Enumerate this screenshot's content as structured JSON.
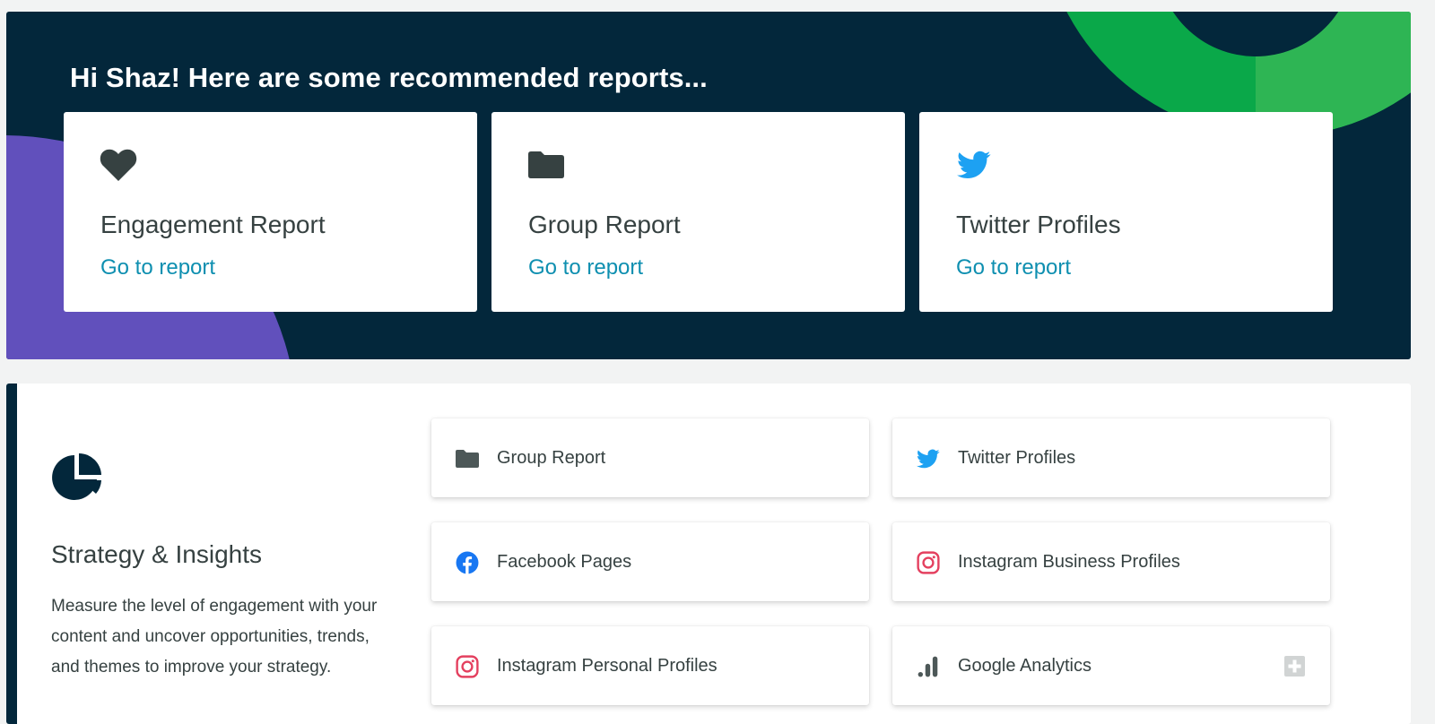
{
  "hero": {
    "title": "Hi Shaz! Here are some recommended reports...",
    "cards": [
      {
        "icon": "heart-icon",
        "title": "Engagement Report",
        "link": "Go to report"
      },
      {
        "icon": "folder-icon",
        "title": "Group Report",
        "link": "Go to report"
      },
      {
        "icon": "twitter-icon",
        "title": "Twitter Profiles",
        "link": "Go to report"
      }
    ]
  },
  "section": {
    "icon": "pie-chart-icon",
    "title": "Strategy & Insights",
    "description": "Measure the level of engagement with your content and uncover opportunities, trends, and themes to improve your strategy.",
    "links": [
      {
        "icon": "folder-icon",
        "label": "Group Report"
      },
      {
        "icon": "twitter-icon",
        "label": "Twitter Profiles"
      },
      {
        "icon": "facebook-icon",
        "label": "Facebook Pages"
      },
      {
        "icon": "instagram-icon",
        "label": "Instagram Business Profiles"
      },
      {
        "icon": "instagram-icon",
        "label": "Instagram Personal Profiles"
      },
      {
        "icon": "bar-chart-icon",
        "label": "Google Analytics",
        "badge_icon": "plus-icon"
      }
    ]
  },
  "colors": {
    "hero_bg": "#03273b",
    "link_blue": "#0e8fb0",
    "twitter": "#1da1f2",
    "facebook": "#1877f2",
    "instagram": "#e4405f",
    "purple": "#6150bc",
    "green": "#0aa849"
  }
}
